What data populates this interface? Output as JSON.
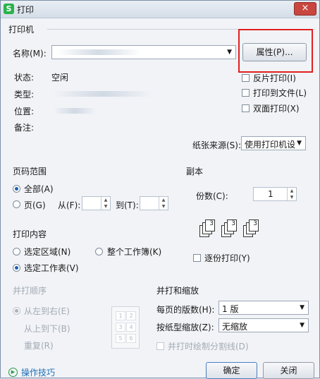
{
  "window": {
    "title": "打印",
    "close": "×",
    "app_icon": "S"
  },
  "printer": {
    "group": "打印机",
    "name_label": "名称(M):",
    "name_value": "",
    "properties_btn": "属性(P)...",
    "status_label": "状态:",
    "status_value": "空闲",
    "type_label": "类型:",
    "location_label": "位置:",
    "comment_label": "备注:",
    "reverse_print": "反片打印(I)",
    "print_to_file": "打印到文件(L)",
    "duplex": "双面打印(X)",
    "paper_source_label": "纸张来源(S):",
    "paper_source_value": "使用打印机设"
  },
  "page_range": {
    "group": "页码范围",
    "all": "全部(A)",
    "pages": "页(G)",
    "from_label": "从(F):",
    "to_label": "到(T):"
  },
  "copies": {
    "group": "副本",
    "count_label": "份数(C):",
    "count_value": "1",
    "collate": "逐份打印(Y)"
  },
  "print_content": {
    "group": "打印内容",
    "selection": "选定区域(N)",
    "workbook": "整个工作簿(K)",
    "sheet": "选定工作表(V)"
  },
  "print_order": {
    "group": "并打顺序",
    "left_to_right": "从左到右(E)",
    "top_to_bottom": "从上到下(B)",
    "repeat": "重复(R)",
    "grid": [
      "1",
      "2",
      "3",
      "4",
      "5",
      "6"
    ]
  },
  "zoom": {
    "group": "并打和缩放",
    "pages_per_sheet_label": "每页的版数(H):",
    "pages_per_sheet_value": "1 版",
    "scale_label": "按纸型缩放(Z):",
    "scale_value": "无缩放",
    "draw_lines": "并打时绘制分割线(D)"
  },
  "footer": {
    "tips": "操作技巧",
    "ok": "确定",
    "close": "关闭"
  },
  "colors": {
    "highlight": "#e02020",
    "accent": "#2bb24c"
  }
}
